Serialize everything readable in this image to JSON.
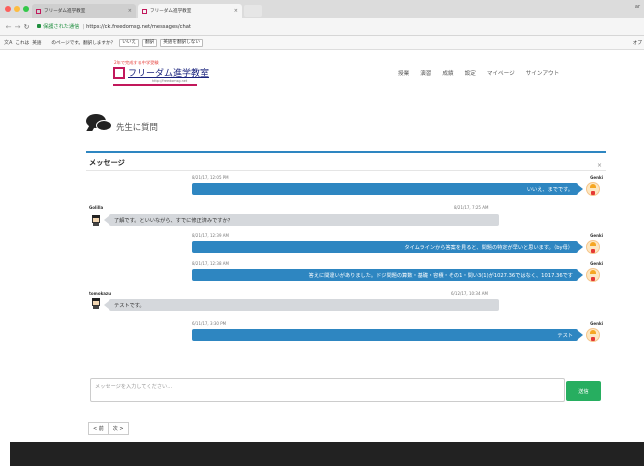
{
  "browser": {
    "tabs": [
      {
        "label": "フリーダム進学教室"
      },
      {
        "label": "フリーダム進学教室"
      }
    ],
    "profile_initial": "ar",
    "address": {
      "secure_label": "保護された通信",
      "url": "https://ck.freedomsg.net/messages/chat"
    },
    "translate_bar": {
      "lead": "これは",
      "language": "英語",
      "question": "のページです。翻訳しますか？",
      "no_label": "いいえ",
      "translate_label": "翻訳",
      "never_label": "英語を翻訳しない",
      "options_label": "オプ"
    }
  },
  "site": {
    "logo_tagline": "2年で完成する中学受験",
    "logo_title": "フリーダム進学教室",
    "logo_url": "http://freedomsg.net",
    "nav": [
      "授業",
      "演習",
      "成績",
      "設定",
      "マイページ",
      "サインアウト"
    ]
  },
  "question": {
    "title": "先生に質問"
  },
  "panel": {
    "title": "メッセージ",
    "close_icon": "×"
  },
  "messages": [
    {
      "from": "me",
      "sender": "Genki",
      "time": "8/21/17, 12:05 PM",
      "text": "いいえ、までです。"
    },
    {
      "from": "other",
      "sender": "Golilla",
      "time": "8/21/17, 7:25 AM",
      "text": "了解です。といいながら、すでに修正済みですか？"
    },
    {
      "from": "me",
      "sender": "Genki",
      "time": "8/21/17, 12:39 AM",
      "text": "タイムラインから答案を見ると、問題の特定が早いと思います。（by母）"
    },
    {
      "from": "me",
      "sender": "Genki",
      "time": "8/21/17, 12:38 AM",
      "text": "答えに間違いがありました。ドジ問題の算数・基礎・容積・その1・問い3(1)が1027.36ではなく、1017.36です"
    },
    {
      "from": "other",
      "sender": "tomokazu",
      "time": "6/12/17, 10:34 AM",
      "text": "テストです。"
    },
    {
      "from": "me",
      "sender": "Genki",
      "time": "6/11/17, 3:30 PM",
      "text": "テスト"
    }
  ],
  "composer": {
    "placeholder": "メッセージを入力してください...",
    "send_label": "送信"
  },
  "pager": {
    "prev_label": "< 前",
    "next_label": "次 >"
  }
}
